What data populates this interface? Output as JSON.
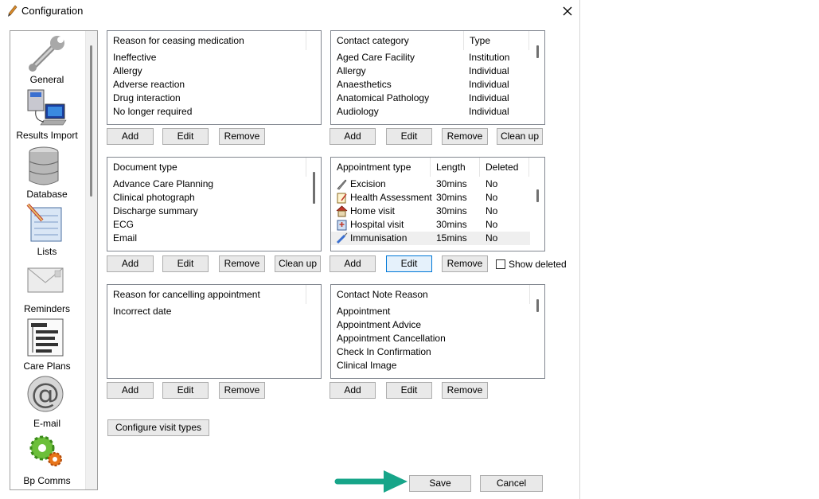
{
  "window": {
    "title": "Configuration"
  },
  "sidebar": {
    "items": [
      {
        "label": "General",
        "icon": "wrench-icon"
      },
      {
        "label": "Results Import",
        "icon": "computer-icon"
      },
      {
        "label": "Database",
        "icon": "database-icon"
      },
      {
        "label": "Lists",
        "icon": "notepad-icon"
      },
      {
        "label": "Reminders",
        "icon": "envelope-icon"
      },
      {
        "label": "Care Plans",
        "icon": "care-plan-icon"
      },
      {
        "label": "E-mail",
        "icon": "at-sign-icon"
      },
      {
        "label": "Bp Comms",
        "icon": "gear-icon"
      }
    ]
  },
  "ceasing": {
    "header": "Reason for ceasing medication",
    "rows": [
      "Ineffective",
      "Allergy",
      "Adverse reaction",
      "Drug interaction",
      "No longer required"
    ]
  },
  "contact_category": {
    "headers": [
      "Contact category",
      "Type"
    ],
    "rows": [
      [
        "Aged Care Facility",
        "Institution"
      ],
      [
        "Allergy",
        "Individual"
      ],
      [
        "Anaesthetics",
        "Individual"
      ],
      [
        "Anatomical Pathology",
        "Individual"
      ],
      [
        "Audiology",
        "Individual"
      ]
    ]
  },
  "document_type": {
    "header": "Document type",
    "rows": [
      "Advance Care Planning",
      "Clinical photograph",
      "Discharge summary",
      "ECG",
      "Email"
    ]
  },
  "appointment_type": {
    "headers": [
      "Appointment type",
      "Length",
      "Deleted"
    ],
    "rows": [
      [
        "Excision",
        "30mins",
        "No"
      ],
      [
        "Health Assessment",
        "30mins",
        "No"
      ],
      [
        "Home visit",
        "30mins",
        "No"
      ],
      [
        "Hospital visit",
        "30mins",
        "No"
      ],
      [
        "Immunisation",
        "15mins",
        "No"
      ]
    ],
    "row_icons": [
      "scalpel-icon",
      "clipboard-icon",
      "house-icon",
      "hospital-icon",
      "syringe-icon"
    ]
  },
  "cancelling": {
    "header": "Reason for cancelling appointment",
    "rows": [
      "Incorrect date"
    ]
  },
  "contact_note": {
    "header": "Contact Note Reason",
    "rows": [
      "Appointment",
      "Appointment Advice",
      "Appointment Cancellation",
      "Check In Confirmation",
      "Clinical Image"
    ]
  },
  "buttons": {
    "add": "Add",
    "edit": "Edit",
    "remove": "Remove",
    "clean_up": "Clean up",
    "configure_visit_types": "Configure visit types",
    "save": "Save",
    "cancel": "Cancel"
  },
  "show_deleted": {
    "label": "Show deleted",
    "checked": false
  },
  "colors": {
    "arrow": "#17a589",
    "focus_border": "#0078d7"
  }
}
